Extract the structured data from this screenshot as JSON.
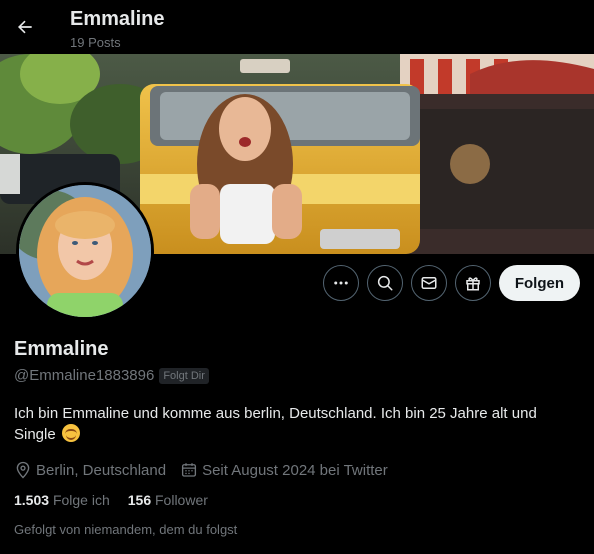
{
  "header": {
    "name": "Emmaline",
    "posts": "19 Posts"
  },
  "profile": {
    "display_name": "Emmaline",
    "handle": "@Emmaline1883896",
    "follows_you_badge": "Folgt Dir",
    "bio": "Ich bin Emmaline und komme aus berlin, Deutschland. Ich bin 25 Jahre alt und Single",
    "location": "Berlin, Deutschland",
    "joined": "Seit August 2024 bei Twitter",
    "following_count": "1.503",
    "following_label": "Folge ich",
    "followers_count": "156",
    "followers_label": "Follower",
    "followed_by": "Gefolgt von niemandem, dem du folgst"
  },
  "actions": {
    "follow_label": "Folgen"
  },
  "colors": {
    "background": "#000000",
    "text": "#e7e9ea",
    "muted": "#71767b",
    "follow_button_bg": "#eff3f4"
  }
}
